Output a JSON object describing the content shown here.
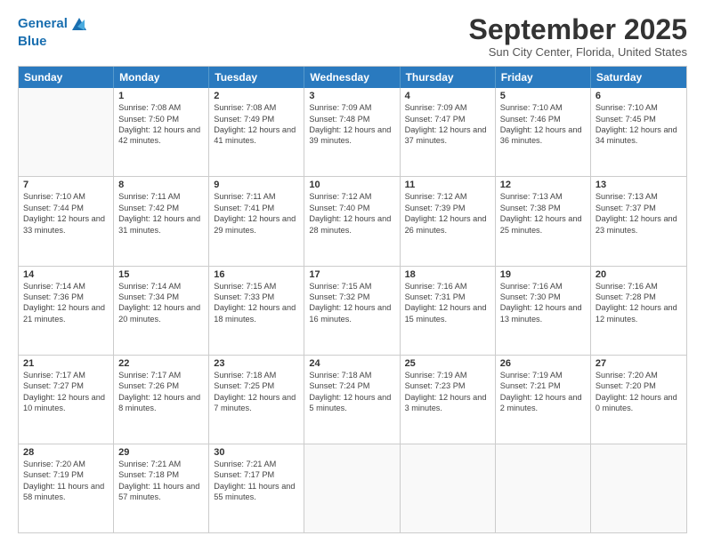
{
  "header": {
    "logo_line1": "General",
    "logo_line2": "Blue",
    "month_title": "September 2025",
    "location": "Sun City Center, Florida, United States"
  },
  "days_of_week": [
    "Sunday",
    "Monday",
    "Tuesday",
    "Wednesday",
    "Thursday",
    "Friday",
    "Saturday"
  ],
  "weeks": [
    [
      {
        "day": "",
        "empty": true
      },
      {
        "day": "1",
        "sunrise": "7:08 AM",
        "sunset": "7:50 PM",
        "daylight": "12 hours and 42 minutes."
      },
      {
        "day": "2",
        "sunrise": "7:08 AM",
        "sunset": "7:49 PM",
        "daylight": "12 hours and 41 minutes."
      },
      {
        "day": "3",
        "sunrise": "7:09 AM",
        "sunset": "7:48 PM",
        "daylight": "12 hours and 39 minutes."
      },
      {
        "day": "4",
        "sunrise": "7:09 AM",
        "sunset": "7:47 PM",
        "daylight": "12 hours and 37 minutes."
      },
      {
        "day": "5",
        "sunrise": "7:10 AM",
        "sunset": "7:46 PM",
        "daylight": "12 hours and 36 minutes."
      },
      {
        "day": "6",
        "sunrise": "7:10 AM",
        "sunset": "7:45 PM",
        "daylight": "12 hours and 34 minutes."
      }
    ],
    [
      {
        "day": "7",
        "sunrise": "7:10 AM",
        "sunset": "7:44 PM",
        "daylight": "12 hours and 33 minutes."
      },
      {
        "day": "8",
        "sunrise": "7:11 AM",
        "sunset": "7:42 PM",
        "daylight": "12 hours and 31 minutes."
      },
      {
        "day": "9",
        "sunrise": "7:11 AM",
        "sunset": "7:41 PM",
        "daylight": "12 hours and 29 minutes."
      },
      {
        "day": "10",
        "sunrise": "7:12 AM",
        "sunset": "7:40 PM",
        "daylight": "12 hours and 28 minutes."
      },
      {
        "day": "11",
        "sunrise": "7:12 AM",
        "sunset": "7:39 PM",
        "daylight": "12 hours and 26 minutes."
      },
      {
        "day": "12",
        "sunrise": "7:13 AM",
        "sunset": "7:38 PM",
        "daylight": "12 hours and 25 minutes."
      },
      {
        "day": "13",
        "sunrise": "7:13 AM",
        "sunset": "7:37 PM",
        "daylight": "12 hours and 23 minutes."
      }
    ],
    [
      {
        "day": "14",
        "sunrise": "7:14 AM",
        "sunset": "7:36 PM",
        "daylight": "12 hours and 21 minutes."
      },
      {
        "day": "15",
        "sunrise": "7:14 AM",
        "sunset": "7:34 PM",
        "daylight": "12 hours and 20 minutes."
      },
      {
        "day": "16",
        "sunrise": "7:15 AM",
        "sunset": "7:33 PM",
        "daylight": "12 hours and 18 minutes."
      },
      {
        "day": "17",
        "sunrise": "7:15 AM",
        "sunset": "7:32 PM",
        "daylight": "12 hours and 16 minutes."
      },
      {
        "day": "18",
        "sunrise": "7:16 AM",
        "sunset": "7:31 PM",
        "daylight": "12 hours and 15 minutes."
      },
      {
        "day": "19",
        "sunrise": "7:16 AM",
        "sunset": "7:30 PM",
        "daylight": "12 hours and 13 minutes."
      },
      {
        "day": "20",
        "sunrise": "7:16 AM",
        "sunset": "7:28 PM",
        "daylight": "12 hours and 12 minutes."
      }
    ],
    [
      {
        "day": "21",
        "sunrise": "7:17 AM",
        "sunset": "7:27 PM",
        "daylight": "12 hours and 10 minutes."
      },
      {
        "day": "22",
        "sunrise": "7:17 AM",
        "sunset": "7:26 PM",
        "daylight": "12 hours and 8 minutes."
      },
      {
        "day": "23",
        "sunrise": "7:18 AM",
        "sunset": "7:25 PM",
        "daylight": "12 hours and 7 minutes."
      },
      {
        "day": "24",
        "sunrise": "7:18 AM",
        "sunset": "7:24 PM",
        "daylight": "12 hours and 5 minutes."
      },
      {
        "day": "25",
        "sunrise": "7:19 AM",
        "sunset": "7:23 PM",
        "daylight": "12 hours and 3 minutes."
      },
      {
        "day": "26",
        "sunrise": "7:19 AM",
        "sunset": "7:21 PM",
        "daylight": "12 hours and 2 minutes."
      },
      {
        "day": "27",
        "sunrise": "7:20 AM",
        "sunset": "7:20 PM",
        "daylight": "12 hours and 0 minutes."
      }
    ],
    [
      {
        "day": "28",
        "sunrise": "7:20 AM",
        "sunset": "7:19 PM",
        "daylight": "11 hours and 58 minutes."
      },
      {
        "day": "29",
        "sunrise": "7:21 AM",
        "sunset": "7:18 PM",
        "daylight": "11 hours and 57 minutes."
      },
      {
        "day": "30",
        "sunrise": "7:21 AM",
        "sunset": "7:17 PM",
        "daylight": "11 hours and 55 minutes."
      },
      {
        "day": "",
        "empty": true
      },
      {
        "day": "",
        "empty": true
      },
      {
        "day": "",
        "empty": true
      },
      {
        "day": "",
        "empty": true
      }
    ]
  ]
}
